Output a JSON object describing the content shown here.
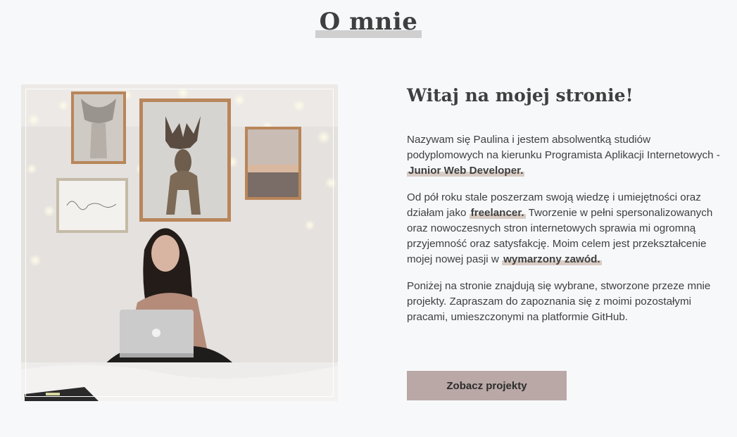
{
  "section": {
    "title": "O mnie"
  },
  "about": {
    "heading": "Witaj na mojej stronie!",
    "p1": {
      "text": "Nazywam się Paulina i jestem absolwentką studiów podyplomowych na kierunku Programista Aplikacji Internetowych - ",
      "highlight": "Junior Web Developer."
    },
    "p2": {
      "text_before": "Od pół roku stale poszerzam swoją wiedzę i umiejętności oraz działam jako ",
      "highlight1": "freelancer.",
      "text_middle": " Tworzenie w pełni spersonalizowanych oraz nowoczesnych stron internetowych sprawia mi ogromną przyjemność oraz satysfakcję. Moim celem jest przekształcenie mojej nowej pasji w ",
      "highlight2": "wymarzony zawód."
    },
    "p3": "Poniżej na stronie znajdują się wybrane, stworzone przeze mnie projekty. Zapraszam do zapoznania się z moimi pozostałymi pracami, umieszczonymi na platformie GitHub.",
    "button_label": "Zobacz projekty"
  },
  "colors": {
    "background": "#f7f8fa",
    "highlight": "#d8ccc4",
    "button": "#b9a8a6",
    "title_underline": "#cfcfcf"
  }
}
